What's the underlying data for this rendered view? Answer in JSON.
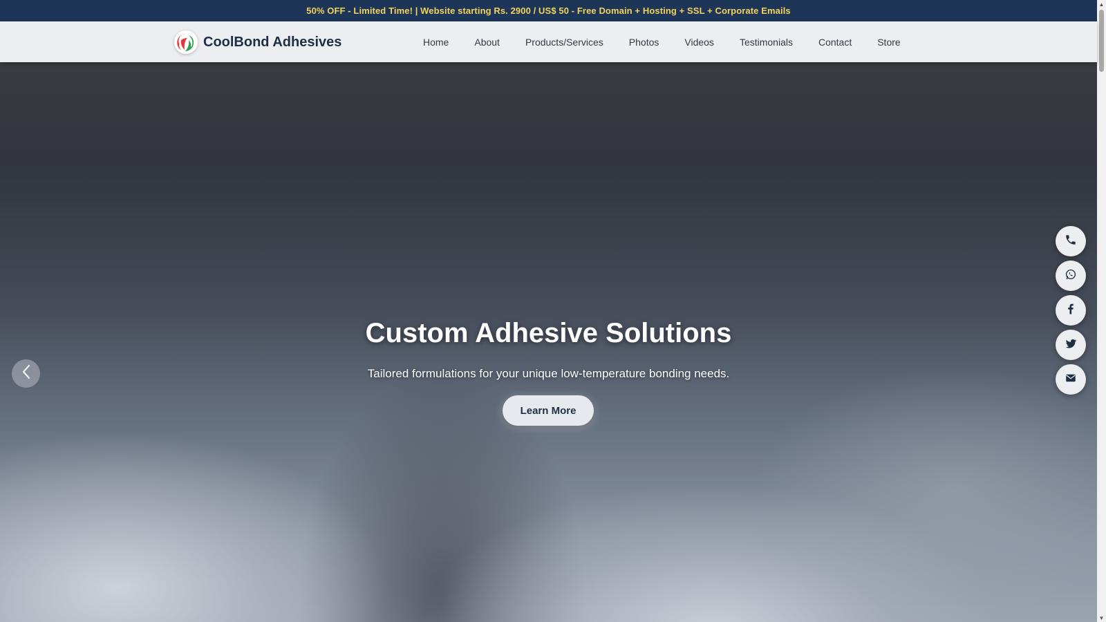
{
  "promo": {
    "text": "50% OFF - Limited Time! | Website starting Rs. 2900 / US$ 50 - Free Domain + Hosting + SSL + Corporate Emails"
  },
  "header": {
    "brand_name": "CoolBond Adhesives",
    "nav": [
      {
        "label": "Home"
      },
      {
        "label": "About"
      },
      {
        "label": "Products/Services"
      },
      {
        "label": "Photos"
      },
      {
        "label": "Videos"
      },
      {
        "label": "Testimonials"
      },
      {
        "label": "Contact"
      },
      {
        "label": "Store"
      }
    ]
  },
  "hero": {
    "title": "Custom Adhesive Solutions",
    "subtitle": "Tailored formulations for your unique low-temperature bonding needs.",
    "cta_label": "Learn More"
  },
  "social": [
    "phone-icon",
    "whatsapp-icon",
    "facebook-icon",
    "twitter-icon",
    "mail-icon"
  ],
  "colors": {
    "promo_bg": "#1d3557",
    "promo_text": "#f4d35e",
    "brand_text": "#1e2f45",
    "logo_red": "#e03a3e",
    "logo_green": "#2e9e4f"
  }
}
